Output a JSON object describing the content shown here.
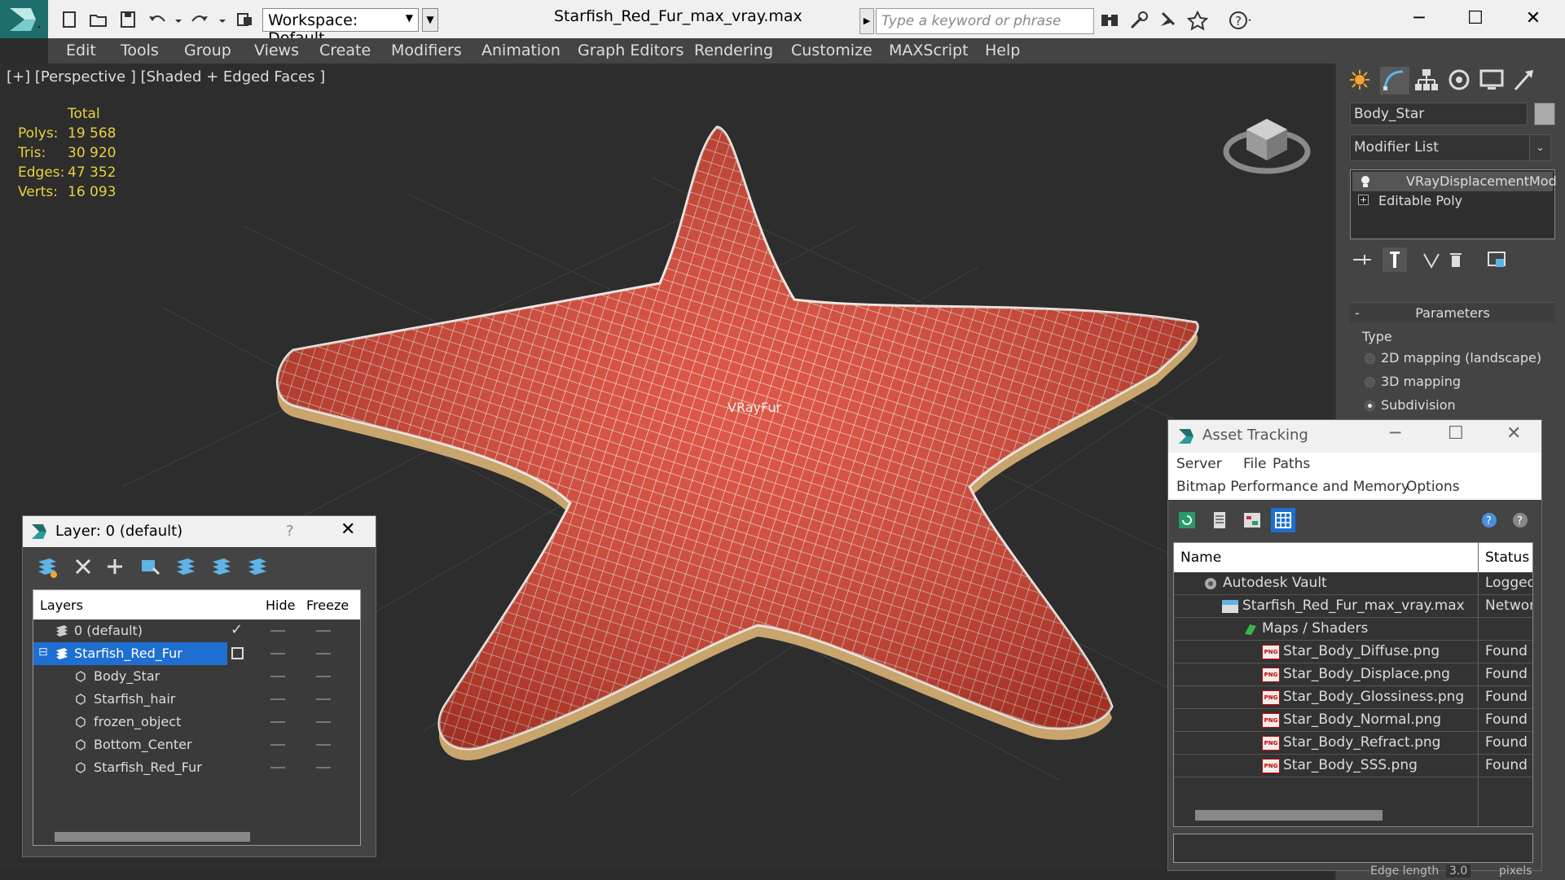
{
  "titlebar": {
    "workspace": "Workspace: Default",
    "document_title": "Starfish_Red_Fur_max_vray.max",
    "search_placeholder": "Type a keyword or phrase"
  },
  "menu": [
    "Edit",
    "Tools",
    "Group",
    "Views",
    "Create",
    "Modifiers",
    "Animation",
    "Graph Editors",
    "Rendering",
    "Customize",
    "MAXScript",
    "Help"
  ],
  "viewport": {
    "label": "[+] [Perspective ] [Shaded + Edged Faces ]",
    "stats_header": "Total",
    "stats": [
      {
        "key": "Polys:",
        "value": "19 568"
      },
      {
        "key": "Tris:",
        "value": "30 920"
      },
      {
        "key": "Edges:",
        "value": "47 352"
      },
      {
        "key": "Verts:",
        "value": "16 093"
      }
    ],
    "object_label": "VRayFur"
  },
  "command_panel": {
    "object_name": "Body_Star",
    "modifier_list": "Modifier List",
    "stack": [
      "VRayDisplacementMod",
      "Editable Poly"
    ],
    "rollout_title": "Parameters",
    "rollout_minus": "-",
    "group_label": "Type",
    "options": [
      {
        "label": "2D mapping (landscape)",
        "selected": false
      },
      {
        "label": "3D mapping",
        "selected": false
      },
      {
        "label": "Subdivision",
        "selected": true
      }
    ]
  },
  "layer_dialog": {
    "title": "Layer: 0 (default)",
    "help": "?",
    "columns": {
      "layers": "Layers",
      "hide": "Hide",
      "freeze": "Freeze"
    },
    "rows": [
      {
        "name": "0 (default)",
        "level": 0,
        "selected": false,
        "current": true
      },
      {
        "name": "Starfish_Red_Fur",
        "level": 0,
        "selected": true,
        "current": false
      },
      {
        "name": "Body_Star",
        "level": 1,
        "selected": false,
        "current": false
      },
      {
        "name": "Starfish_hair",
        "level": 1,
        "selected": false,
        "current": false
      },
      {
        "name": "frozen_object",
        "level": 1,
        "selected": false,
        "current": false
      },
      {
        "name": "Bottom_Center",
        "level": 1,
        "selected": false,
        "current": false
      },
      {
        "name": "Starfish_Red_Fur",
        "level": 1,
        "selected": false,
        "current": false
      }
    ]
  },
  "asset_tracking": {
    "title": "Asset Tracking",
    "menu_row1": [
      "Server",
      "File",
      "Paths"
    ],
    "menu_row2": [
      "Bitmap Performance and Memory",
      "Options"
    ],
    "columns": {
      "name": "Name",
      "status": "Status"
    },
    "rows": [
      {
        "name": "Autodesk Vault",
        "status": "Logged",
        "level": 0,
        "icon": "vault"
      },
      {
        "name": "Starfish_Red_Fur_max_vray.max",
        "status": "Network",
        "level": 1,
        "icon": "max"
      },
      {
        "name": "Maps / Shaders",
        "status": "",
        "level": 2,
        "icon": "maps"
      },
      {
        "name": "Star_Body_Diffuse.png",
        "status": "Found",
        "level": 3,
        "icon": "png"
      },
      {
        "name": "Star_Body_Displace.png",
        "status": "Found",
        "level": 3,
        "icon": "png"
      },
      {
        "name": "Star_Body_Glossiness.png",
        "status": "Found",
        "level": 3,
        "icon": "png"
      },
      {
        "name": "Star_Body_Normal.png",
        "status": "Found",
        "level": 3,
        "icon": "png"
      },
      {
        "name": "Star_Body_Refract.png",
        "status": "Found",
        "level": 3,
        "icon": "png"
      },
      {
        "name": "Star_Body_SSS.png",
        "status": "Found",
        "level": 3,
        "icon": "png"
      }
    ]
  },
  "statusbar": {
    "edge_label": "Edge length",
    "edge_value": "3.0",
    "unit": "pixels"
  },
  "colors": {
    "accent": "#1e6fd1",
    "stats": "#e6d23c",
    "starfish": "#d9412e"
  }
}
